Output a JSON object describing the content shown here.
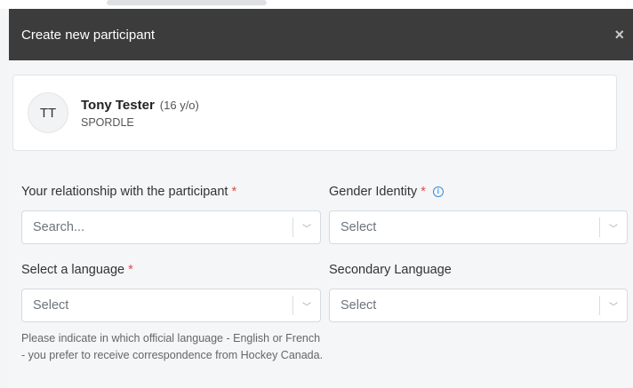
{
  "modal": {
    "title": "Create new participant",
    "close_glyph": "×"
  },
  "participant": {
    "initials": "TT",
    "name": "Tony Tester",
    "age": "(16 y/o)",
    "organization": "SPORDLE"
  },
  "form": {
    "relationship": {
      "label": "Your relationship with the participant",
      "required": "*",
      "placeholder": "Search..."
    },
    "gender": {
      "label": "Gender Identity",
      "required": "*",
      "value": "Select",
      "info_glyph": "i"
    },
    "language": {
      "label": "Select a language",
      "required": "*",
      "value": "Select"
    },
    "secondary_language": {
      "label": "Secondary Language",
      "value": "Select"
    },
    "language_help": "Please indicate in which official language - English or French - you prefer to receive correspondence from Hockey Canada."
  },
  "icons": {
    "chevron": "chevron-down-icon",
    "close": "close-icon",
    "info": "info-icon"
  }
}
